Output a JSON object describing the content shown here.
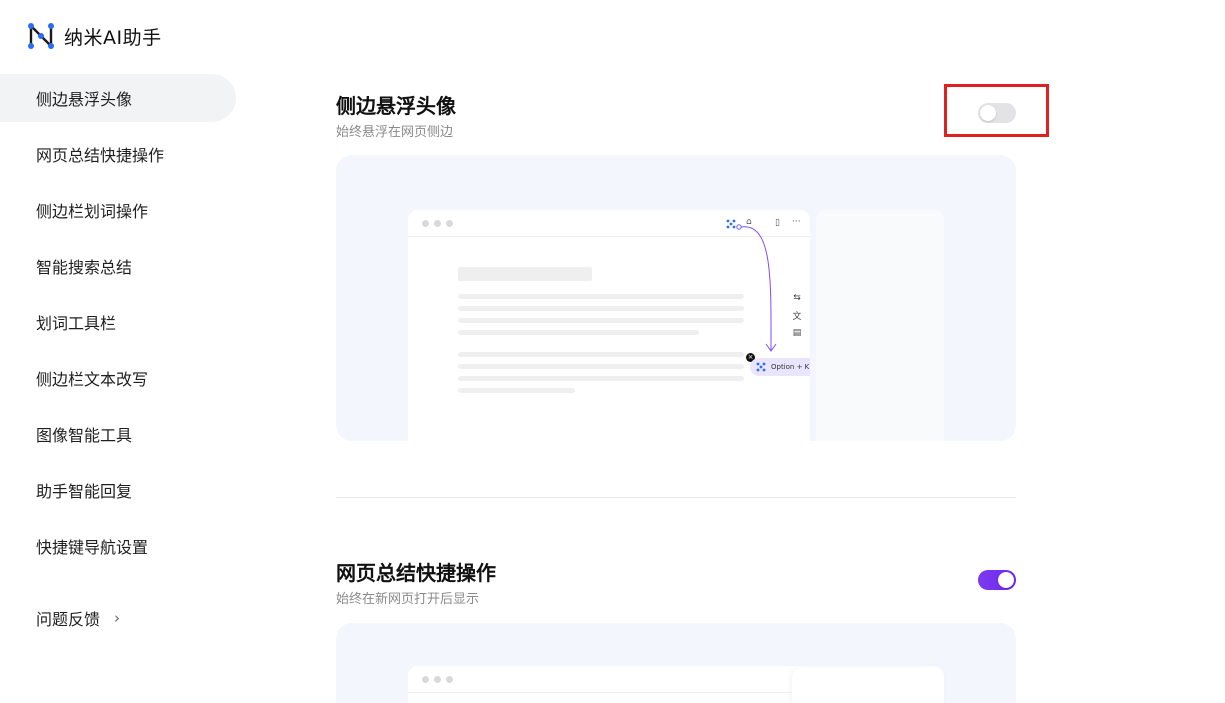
{
  "app": {
    "title": "纳米AI助手",
    "logo_icon": "nano-ai-logo-icon"
  },
  "sidebar": {
    "items": [
      {
        "label": "侧边悬浮头像",
        "active": true
      },
      {
        "label": "网页总结快捷操作",
        "active": false
      },
      {
        "label": "侧边栏划词操作",
        "active": false
      },
      {
        "label": "智能搜索总结",
        "active": false
      },
      {
        "label": "划词工具栏",
        "active": false
      },
      {
        "label": "侧边栏文本改写",
        "active": false
      },
      {
        "label": "图像智能工具",
        "active": false
      },
      {
        "label": "助手智能回复",
        "active": false
      },
      {
        "label": "快捷键导航设置",
        "active": false
      }
    ],
    "feedback": {
      "label": "问题反馈",
      "icon": "chevron-right-icon"
    }
  },
  "sections": [
    {
      "title": "侧边悬浮头像",
      "description": "始终悬浮在网页侧边",
      "toggle_on": false,
      "preview": {
        "shortcut_label": "Option + K"
      }
    },
    {
      "title": "网页总结快捷操作",
      "description": "始终在新网页打开后显示",
      "toggle_on": true
    }
  ],
  "colors": {
    "accent": "#7c3aed",
    "highlight": "#e02020",
    "preview_bg": "#f3f6fc"
  }
}
